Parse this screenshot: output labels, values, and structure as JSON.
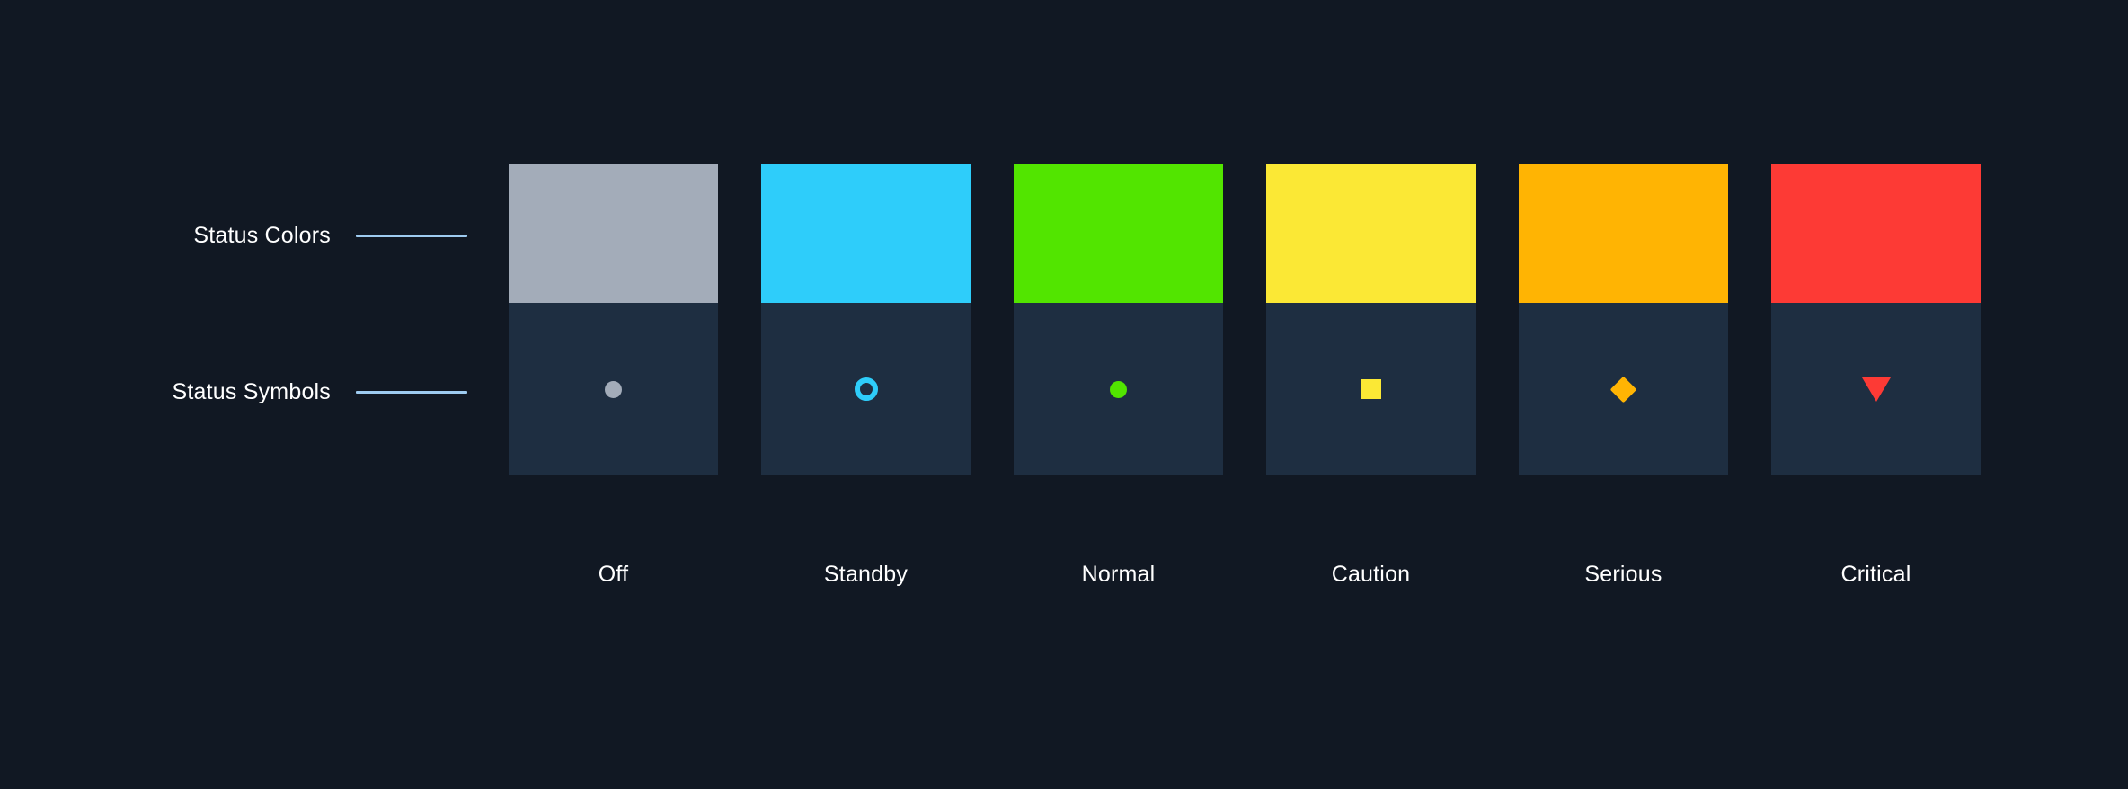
{
  "page": {
    "background": "#111823",
    "panel_background": "#1e2e41",
    "text_color": "#ffffff",
    "connector_color": "#9ecbf0"
  },
  "rows": [
    {
      "label": "Status Colors",
      "connector": "line"
    },
    {
      "label": "Status Symbols",
      "connector": "line"
    }
  ],
  "statuses": [
    {
      "name": "Off",
      "color": "#a3acb9",
      "symbol": "filled-circle-icon",
      "symbol_color": "#a3acb9"
    },
    {
      "name": "Standby",
      "color": "#2ecdfa",
      "symbol": "ring-circle-icon",
      "symbol_color": "#2ecdfa"
    },
    {
      "name": "Normal",
      "color": "#52e500",
      "symbol": "filled-circle-icon",
      "symbol_color": "#52e500"
    },
    {
      "name": "Caution",
      "color": "#fbe835",
      "symbol": "filled-square-icon",
      "symbol_color": "#fbe835"
    },
    {
      "name": "Serious",
      "color": "#ffb403",
      "symbol": "filled-diamond-icon",
      "symbol_color": "#ffb403"
    },
    {
      "name": "Critical",
      "color": "#fd3a35",
      "symbol": "down-triangle-icon",
      "symbol_color": "#fd3a35"
    }
  ]
}
